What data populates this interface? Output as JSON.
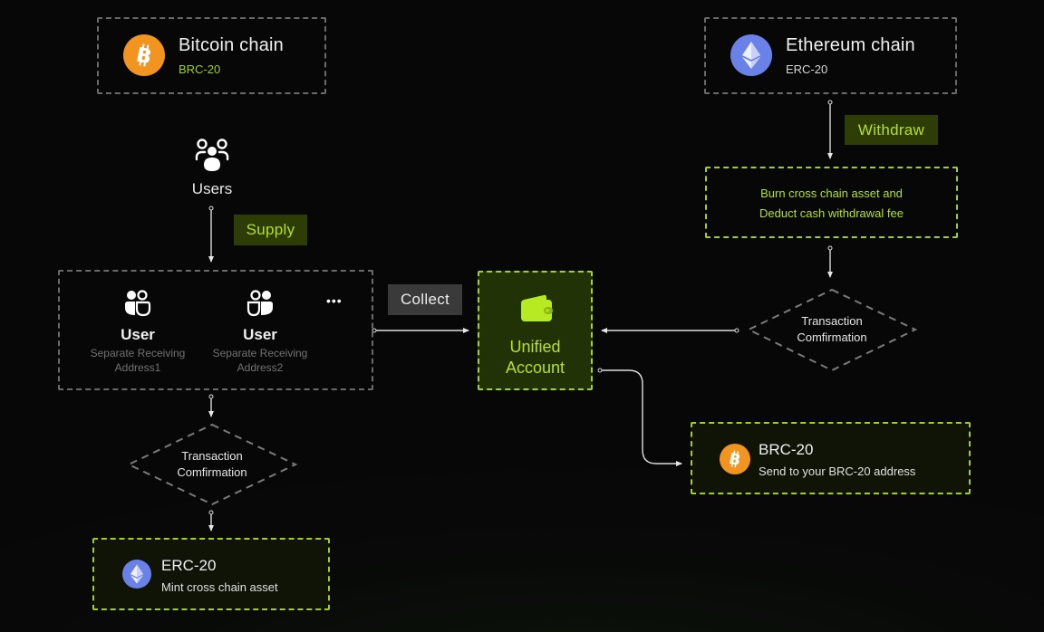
{
  "bitcoin_chain": {
    "title": "Bitcoin chain",
    "subtitle": "BRC-20",
    "icon": "bitcoin-icon"
  },
  "ethereum_chain": {
    "title": "Ethereum chain",
    "subtitle": "ERC-20",
    "icon": "ethereum-icon"
  },
  "users": {
    "label": "Users",
    "icon": "users-group-icon"
  },
  "supply_tag": "Supply",
  "user_group": {
    "users": [
      {
        "label": "User",
        "desc_line1": "Separate Receiving",
        "desc_line2": "Address1",
        "icon": "user-pair-icon"
      },
      {
        "label": "User",
        "desc_line1": "Separate Receiving",
        "desc_line2": "Address2",
        "icon": "user-pair-icon"
      }
    ],
    "more": "•••"
  },
  "collect_tag": "Collect",
  "unified_account": {
    "line1": "Unified",
    "line2": "Account",
    "icon": "wallet-icon"
  },
  "withdraw_tag": "Withdraw",
  "burn_box": {
    "line1": "Burn cross chain asset and",
    "line2": "Deduct cash withdrawal fee"
  },
  "tx_confirm_right": {
    "line1": "Transaction",
    "line2": "Comfirmation"
  },
  "tx_confirm_left": {
    "line1": "Transaction",
    "line2": "Comfirmation"
  },
  "brc20_send": {
    "title": "BRC-20",
    "desc": "Send to your BRC-20 address",
    "icon": "bitcoin-icon"
  },
  "erc20_mint": {
    "title": "ERC-20",
    "desc": "Mint cross chain asset",
    "icon": "ethereum-icon"
  },
  "colors": {
    "accent_green": "#b6e02a",
    "bitcoin_orange": "#f29420",
    "ethereum_blue": "#6a81e8",
    "dashed_gray": "#6a6a6a"
  }
}
